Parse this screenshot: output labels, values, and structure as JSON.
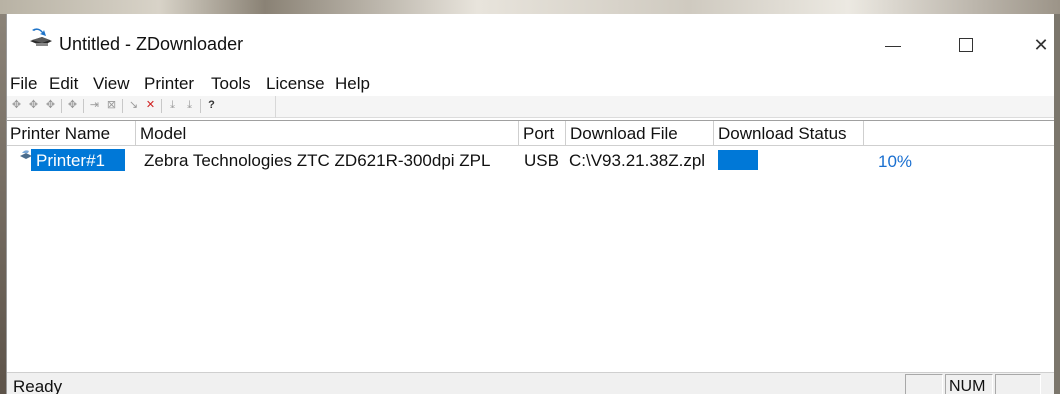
{
  "window": {
    "title": "Untitled - ZDownloader",
    "controls": {
      "minimize": "—",
      "maximize": "☐",
      "close": "✕"
    }
  },
  "menu": {
    "items": [
      "File",
      "Edit",
      "View",
      "Printer",
      "Tools",
      "License",
      "Help"
    ]
  },
  "toolbar": {
    "icons": [
      "connect-printer-icon",
      "refresh-printer-icon",
      "remove-printer-icon",
      "printer-properties-icon",
      "add-file-icon",
      "remove-file-icon",
      "send-icon",
      "cancel-icon",
      "download-all-icon",
      "download-selected-icon",
      "help-icon"
    ]
  },
  "table": {
    "columns": [
      "Printer Name",
      "Model",
      "Port",
      "Download File",
      "Download Status"
    ],
    "rows": [
      {
        "name": "Printer#1",
        "model": "Zebra Technologies  ZTC ZD621R-300dpi ZPL",
        "port": "USB",
        "file": "C:\\V93.21.38Z.zpl",
        "progress": 0.1,
        "progress_label": "10%"
      }
    ]
  },
  "status": {
    "text": "Ready",
    "num": "NUM"
  },
  "colors": {
    "accent": "#0078d7",
    "progress_text": "#1a6fd0"
  }
}
